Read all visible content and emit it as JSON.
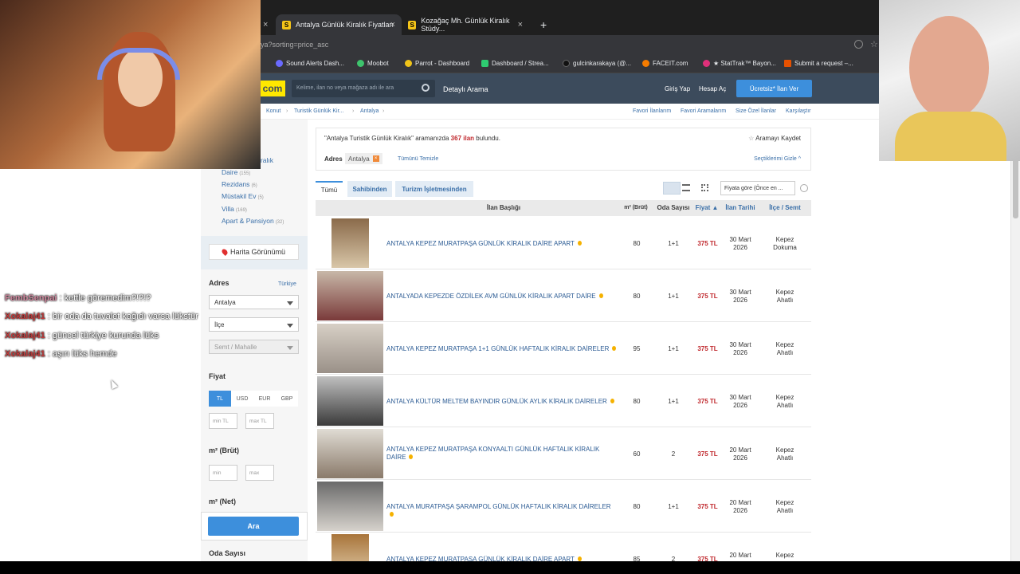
{
  "browser": {
    "tabs": [
      {
        "label": "Antalya Günlük Kiralık Fiyatları",
        "close": "×"
      },
      {
        "label": "Kozağaç Mh. Günlük Kiralık Stüdy...",
        "close": "×"
      }
    ],
    "new_tab": "+",
    "url": "lya?sorting=price_asc",
    "bookmarks": [
      "Sound Alerts Dash...",
      "Moobot",
      "Parrot - Dashboard",
      "Dashboard / Strea...",
      "gulcinkarakaya (@...",
      "FACEIT.com",
      "★ StatTrak™ Bayon...",
      "Submit a request –..."
    ]
  },
  "site": {
    "logo": "com",
    "search_placeholder": "Kelime, ilan no veya mağaza adı ile ara",
    "detailed_search": "Detaylı Arama",
    "login": "Giriş Yap",
    "signup": "Hesap Aç",
    "post_ad": "Ücretsiz* İlan Ver",
    "breadcrumb": [
      "Konut",
      "›",
      "Turistik Günlük Kir...",
      "›",
      "Antalya",
      "›"
    ],
    "right_links": [
      "Favori İlanlarım",
      "Favori Aramalarım",
      "Size Özel İlanlar",
      "Karşılaştır"
    ]
  },
  "sidebar": {
    "category_partial": "ük Kiralık",
    "categories": [
      {
        "label": "Daire",
        "count": "(155)"
      },
      {
        "label": "Rezidans",
        "count": "(6)"
      },
      {
        "label": "Müstakil Ev",
        "count": "(5)"
      },
      {
        "label": "Villa",
        "count": "(169)"
      },
      {
        "label": "Apart & Pansiyon",
        "count": "(32)"
      }
    ],
    "map_view": "Harita Görünümü",
    "address_heading": "Adres",
    "country_link": "Türkiye",
    "city_value": "Antalya",
    "district_placeholder": "İlçe",
    "neighborhood_placeholder": "Semt / Mahalle",
    "price_heading": "Fiyat",
    "currencies": [
      "TL",
      "USD",
      "EUR",
      "GBP"
    ],
    "min_tl": "min TL",
    "max_tl": "max TL",
    "gross_heading": "m² (Brüt)",
    "min": "min",
    "max": "max",
    "net_heading": "m² (Net)",
    "search_button": "Ara",
    "rooms_heading": "Oda Sayısı"
  },
  "results": {
    "query_quote": "\"Antalya Turistik Günlük Kiralık\"",
    "query_suffix": "aramanızda",
    "count": "367 ilan",
    "found": "bulundu.",
    "save_search": "Aramayı Kaydet",
    "address_label": "Adres",
    "address_chip": "Antalya",
    "clear_all": "Tümünü Temizle",
    "hide_selections": "Seçtiklerimi Gizle ^",
    "tabs": [
      "Tümü",
      "Sahibinden",
      "Turizm İşletmesinden"
    ],
    "sort": "Fiyata göre (Önce en ...",
    "columns": [
      "İlan Başlığı",
      "m² (Brüt)",
      "Oda Sayısı",
      "Fiyat ▲",
      "İlan Tarihi",
      "İlçe / Semt"
    ],
    "rows": [
      {
        "title": "ANTALYA KEPEZ MURATPAŞA GÜNLÜK KİRALIK DAİRE APART",
        "m2": "80",
        "rooms": "1+1",
        "price": "375 TL",
        "date1": "30 Mart",
        "date2": "2026",
        "loc1": "Kepez",
        "loc2": "Dokuma"
      },
      {
        "title": "ANTALYADA KEPEZDE ÖZDİLEK AVM GÜNLÜK KİRALIK APART DAİRE",
        "m2": "80",
        "rooms": "1+1",
        "price": "375 TL",
        "date1": "30 Mart",
        "date2": "2026",
        "loc1": "Kepez",
        "loc2": "Ahatlı"
      },
      {
        "title": "ANTALYA KEPEZ MURATPAŞA 1+1 GÜNLÜK HAFTALIK KİRALIK DAİRELER",
        "m2": "95",
        "rooms": "1+1",
        "price": "375 TL",
        "date1": "30 Mart",
        "date2": "2026",
        "loc1": "Kepez",
        "loc2": "Ahatlı"
      },
      {
        "title": "ANTALYA KÜLTÜR MELTEM BAYINDIR GÜNLÜK AYLIK KİRALIK DAİRELER",
        "m2": "80",
        "rooms": "1+1",
        "price": "375 TL",
        "date1": "30 Mart",
        "date2": "2026",
        "loc1": "Kepez",
        "loc2": "Ahatlı"
      },
      {
        "title": "ANTALYA KEPEZ MURATPAŞA KONYAALTI GÜNLÜK HAFTALIK KİRALIK DAİRE",
        "m2": "60",
        "rooms": "2",
        "price": "375 TL",
        "date1": "20 Mart",
        "date2": "2026",
        "loc1": "Kepez",
        "loc2": "Ahatlı"
      },
      {
        "title": "ANTALYA MURATPAŞA ŞARAMPOL GÜNLÜK HAFTALIK KİRALIK DAİRELER",
        "m2": "80",
        "rooms": "1+1",
        "price": "375 TL",
        "date1": "20 Mart",
        "date2": "2026",
        "loc1": "Kepez",
        "loc2": "Ahatlı"
      },
      {
        "title": "ANTALYA KEPEZ MURATPAŞA GÜNLÜK KİRALIK DAİRE APART",
        "m2": "85",
        "rooms": "2",
        "price": "375 TL",
        "date1": "20 Mart",
        "date2": "",
        "loc1": "Kepez",
        "loc2": ""
      }
    ]
  },
  "chat": [
    {
      "user": "FembSenpai",
      "msg": ": kettle göremedim?!?!?"
    },
    {
      "user": "Xokalaj41",
      "msg": ": bir oda da tuvalet kağıdı varsa lükstür"
    },
    {
      "user": "Xokalaj41",
      "msg": ": güncel türkiye kurunda lüks"
    },
    {
      "user": "Xokalaj41",
      "msg": ": aşırı lüks hemde"
    }
  ],
  "colors": {
    "accent": "#3d8fdc",
    "header": "#3c4b5c",
    "logo": "#ffe800",
    "price": "#c0282d",
    "link": "#3a6fa8"
  }
}
